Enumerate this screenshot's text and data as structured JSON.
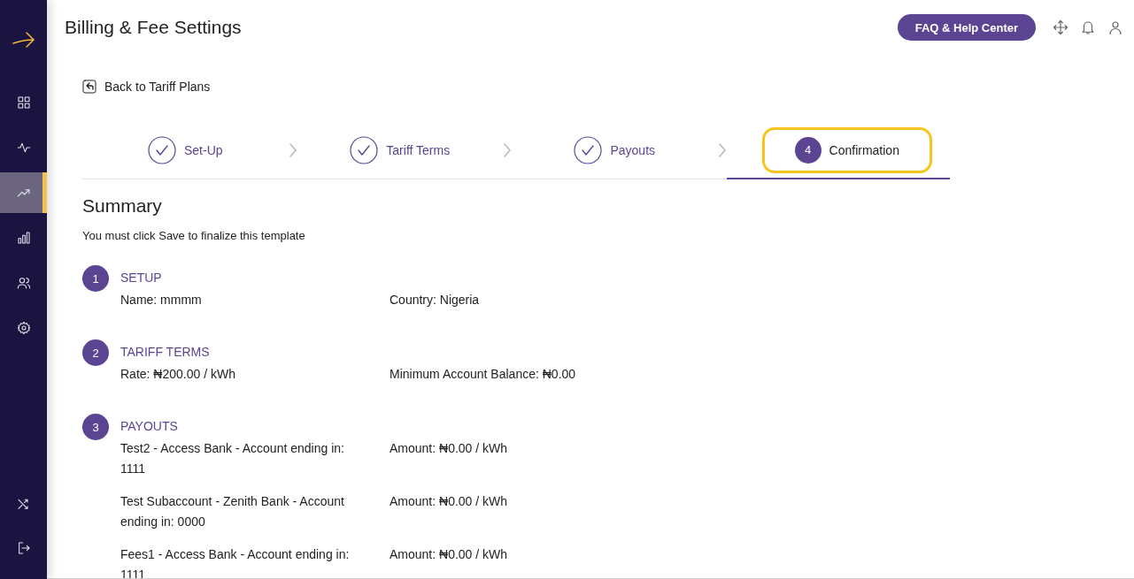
{
  "header": {
    "title": "Billing & Fee Settings",
    "help_button": "FAQ & Help Center"
  },
  "sidebar": {
    "items": [
      {
        "kind": "grid",
        "selected": false
      },
      {
        "kind": "pulse",
        "selected": false
      },
      {
        "kind": "trend",
        "selected": true
      },
      {
        "kind": "bars",
        "selected": false
      },
      {
        "kind": "users",
        "selected": false
      },
      {
        "kind": "gear",
        "selected": false
      }
    ],
    "bottom_items": [
      {
        "kind": "shuffle",
        "selected": false
      },
      {
        "kind": "logout",
        "selected": false
      }
    ]
  },
  "back_link": "Back to Tariff Plans",
  "steps": [
    {
      "label": "Set-Up",
      "done": true,
      "selected": false
    },
    {
      "label": "Tariff Terms",
      "done": true,
      "selected": false
    },
    {
      "label": "Payouts",
      "done": true,
      "selected": false
    },
    {
      "label": "Confirmation",
      "number": "4",
      "done": false,
      "selected": true
    }
  ],
  "summary": {
    "title": "Summary",
    "note": "You must click Save to finalize this template",
    "sections": [
      {
        "number": "1",
        "title": "SETUP",
        "rows": [
          {
            "left": "Name: mmmm",
            "right": "Country: Nigeria"
          }
        ]
      },
      {
        "number": "2",
        "title": "TARIFF TERMS",
        "rows": [
          {
            "left": "Rate: ₦200.00 / kWh",
            "right": "Minimum Account Balance: ₦0.00"
          }
        ]
      },
      {
        "number": "3",
        "title": "PAYOUTS",
        "rows": [
          {
            "left": "Test2 - Access Bank - Account ending in: 1111",
            "right": "Amount: ₦0.00 / kWh"
          },
          {
            "left": "Test Subaccount - Zenith Bank - Account ending in: 0000",
            "right": "Amount: ₦0.00 / kWh"
          },
          {
            "left": "Fees1 - Access Bank - Account ending in: 1111",
            "right": "Amount: ₦0.00 / kWh"
          }
        ]
      }
    ]
  }
}
